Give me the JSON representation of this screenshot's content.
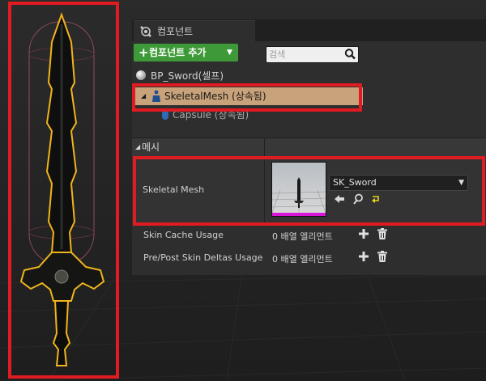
{
  "components_panel": {
    "tab_title": "컴포넌트",
    "add_button_label": "컴포넌트 추가",
    "search_placeholder": "검색",
    "tree": {
      "root": "BP_Sword(셀프)",
      "selected": "SkeletalMesh (상속됨)",
      "child": "Capsule (상속됨)"
    }
  },
  "details": {
    "section_title": "메시",
    "skeletal_mesh_label": "Skeletal Mesh",
    "skeletal_mesh_value": "SK_Sword",
    "skin_cache_label": "Skin Cache Usage",
    "skin_cache_value": "0 배열 엘리먼트",
    "pre_post_label": "Pre/Post Skin Deltas Usage",
    "pre_post_value": "0 배열 엘리먼트"
  },
  "colors": {
    "highlight_red": "#e01b22",
    "add_button_green": "#3e9a38",
    "selection_tan": "#c8a27a",
    "thumbnail_bar_magenta": "#d816d8"
  },
  "icons": [
    "components-tab-icon",
    "plus-icon",
    "dropdown-caret-icon",
    "search-icon",
    "actor-sphere-icon",
    "skeletal-mesh-icon",
    "capsule-icon",
    "use-selected-arrow-icon",
    "browse-magnifier-icon",
    "reset-arrow-icon",
    "add-element-plus-icon",
    "trash-icon",
    "sword-model"
  ]
}
